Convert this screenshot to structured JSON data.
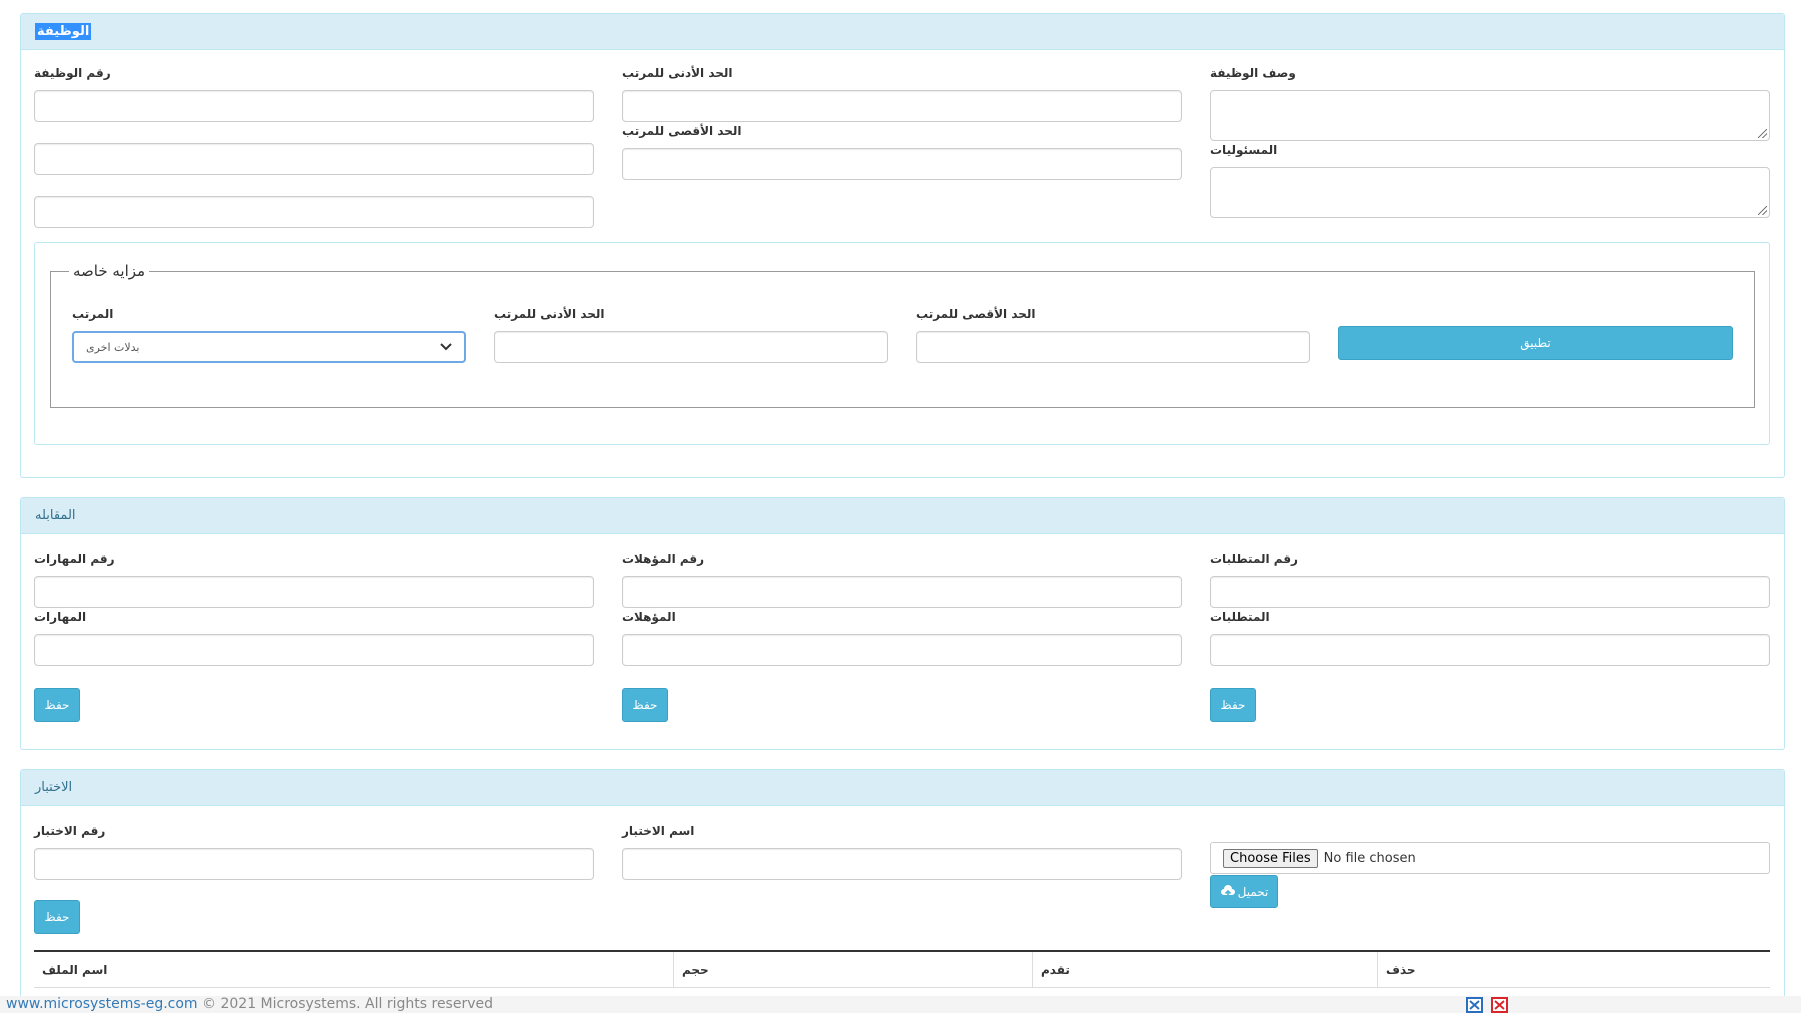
{
  "job_panel": {
    "title": "الوظيفة",
    "job_number_label": "رقم الوظيفة",
    "min_salary_label": "الحد الأدنى للمرتب",
    "max_salary_label": "الحد الأقصى للمرتب",
    "job_description_label": "وصف الوظيفة",
    "responsibilities_label": "المسئوليات",
    "special_benefits": {
      "legend": "مزايه خاصه",
      "salary_label": "المرتب",
      "salary_selected": "بدلات اخرى",
      "min_salary_label": "الحد الأدنى للمرتب",
      "max_salary_label": "الحد الأقصى للمرتب",
      "apply_button": "تطبيق"
    }
  },
  "interview_panel": {
    "title": "المقابله",
    "skills_number_label": "رقم المهارات",
    "qualifications_number_label": "رقم المؤهلات",
    "requirements_number_label": "رقم المتطلبات",
    "skills_label": "المهارات",
    "qualifications_label": "المؤهلات",
    "requirements_label": "المتطلبات",
    "save_button": "حفظ"
  },
  "test_panel": {
    "title": "الاختبار",
    "test_number_label": "رقم الاختبار",
    "test_name_label": "اسم الاختبار",
    "choose_files_button": "Choose Files",
    "no_file_text": "No file chosen",
    "upload_button": "تحميل",
    "save_button": "حفظ",
    "table_headers": {
      "file_name": "اسم الملف",
      "size": "حجم",
      "progress": "تقدم",
      "delete": "حذف"
    }
  },
  "footer": {
    "link_text": "www.microsystems-eg.com",
    "copyright": " © 2021 Microsystems. All rights reserved"
  },
  "colors": {
    "panel_heading_bg": "#d9edf7",
    "panel_border": "#bce8f1",
    "button_bg": "#4ab3d8",
    "heading_text": "#31708f"
  }
}
